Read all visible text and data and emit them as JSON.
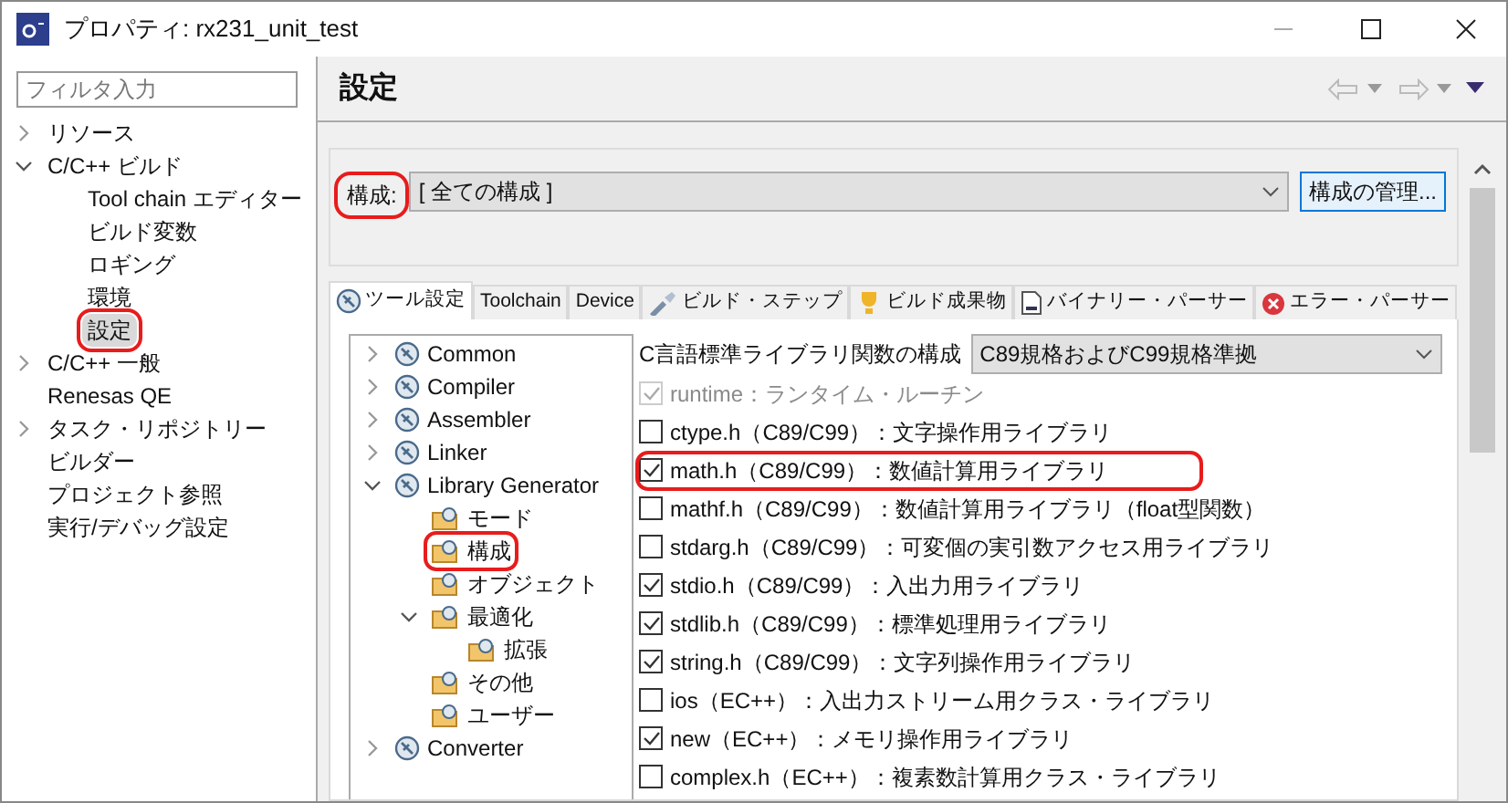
{
  "window": {
    "title": "プロパティ: rx231_unit_test"
  },
  "sidebar": {
    "filter": {
      "placeholder": "フィルタ入力"
    },
    "items": [
      {
        "label": "リソース",
        "expanded": false,
        "selected": false,
        "highlighted": false
      },
      {
        "label": "C/C++ ビルド",
        "expanded": true,
        "selected": false,
        "highlighted": false,
        "children": [
          {
            "label": "Tool chain エディター",
            "selected": false,
            "highlighted": false
          },
          {
            "label": "ビルド変数",
            "selected": false,
            "highlighted": false
          },
          {
            "label": "ロギング",
            "selected": false,
            "highlighted": false
          },
          {
            "label": "環境",
            "selected": false,
            "highlighted": false
          },
          {
            "label": "設定",
            "selected": true,
            "highlighted": true
          }
        ]
      },
      {
        "label": "C/C++ 一般",
        "expanded": false,
        "selected": false,
        "highlighted": false
      },
      {
        "label": "Renesas QE",
        "selected": false,
        "highlighted": false
      },
      {
        "label": "タスク・リポジトリー",
        "expanded": false,
        "selected": false,
        "highlighted": false
      },
      {
        "label": "ビルダー",
        "selected": false,
        "highlighted": false
      },
      {
        "label": "プロジェクト参照",
        "selected": false,
        "highlighted": false
      },
      {
        "label": "実行/デバッグ設定",
        "selected": false,
        "highlighted": false
      }
    ]
  },
  "page": {
    "title": "設定"
  },
  "configuration": {
    "label": "構成:",
    "value": "[ 全ての構成 ]",
    "highlighted": true,
    "manage_button": "構成の管理..."
  },
  "tabs": [
    {
      "label": "ツール設定",
      "selected": true
    },
    {
      "label": "Toolchain",
      "selected": false
    },
    {
      "label": "Device",
      "selected": false
    },
    {
      "label": "ビルド・ステップ",
      "selected": false
    },
    {
      "label": "ビルド成果物",
      "selected": false
    },
    {
      "label": "バイナリー・パーサー",
      "selected": false
    },
    {
      "label": "エラー・パーサー",
      "selected": false
    }
  ],
  "tool_tree": [
    {
      "label": "Common",
      "expanded": false,
      "highlighted": false
    },
    {
      "label": "Compiler",
      "expanded": false,
      "highlighted": false
    },
    {
      "label": "Assembler",
      "expanded": false,
      "highlighted": false
    },
    {
      "label": "Linker",
      "expanded": false,
      "highlighted": false
    },
    {
      "label": "Library Generator",
      "expanded": true,
      "highlighted": false,
      "children": [
        {
          "label": "モード",
          "highlighted": false
        },
        {
          "label": "構成",
          "highlighted": true
        },
        {
          "label": "オブジェクト",
          "highlighted": false
        },
        {
          "label": "最適化",
          "expanded": true,
          "highlighted": false,
          "children": [
            {
              "label": "拡張",
              "highlighted": false
            }
          ]
        },
        {
          "label": "その他",
          "highlighted": false
        },
        {
          "label": "ユーザー",
          "highlighted": false
        }
      ]
    },
    {
      "label": "Converter",
      "expanded": false,
      "highlighted": false
    }
  ],
  "library_config": {
    "label": "C言語標準ライブラリ関数の構成",
    "value": "C89規格およびC99規格準拠"
  },
  "libraries": [
    {
      "label": "runtime：ランタイム・ルーチン",
      "checked": true,
      "disabled": true,
      "highlighted": false
    },
    {
      "label": "ctype.h（C89/C99）：文字操作用ライブラリ",
      "checked": false,
      "disabled": false,
      "highlighted": false
    },
    {
      "label": "math.h（C89/C99）：数値計算用ライブラリ",
      "checked": true,
      "disabled": false,
      "highlighted": true
    },
    {
      "label": "mathf.h（C89/C99）：数値計算用ライブラリ（float型関数）",
      "checked": false,
      "disabled": false,
      "highlighted": false
    },
    {
      "label": "stdarg.h（C89/C99）：可変個の実引数アクセス用ライブラリ",
      "checked": false,
      "disabled": false,
      "highlighted": false
    },
    {
      "label": "stdio.h（C89/C99）：入出力用ライブラリ",
      "checked": true,
      "disabled": false,
      "highlighted": false
    },
    {
      "label": "stdlib.h（C89/C99）：標準処理用ライブラリ",
      "checked": true,
      "disabled": false,
      "highlighted": false
    },
    {
      "label": "string.h（C89/C99）：文字列操作用ライブラリ",
      "checked": true,
      "disabled": false,
      "highlighted": false
    },
    {
      "label": "ios（EC++）：入出力ストリーム用クラス・ライブラリ",
      "checked": false,
      "disabled": false,
      "highlighted": false
    },
    {
      "label": "new（EC++）：メモリ操作用ライブラリ",
      "checked": true,
      "disabled": false,
      "highlighted": false
    },
    {
      "label": "complex.h（EC++）：複素数計算用クラス・ライブラリ",
      "checked": false,
      "disabled": false,
      "highlighted": false
    }
  ]
}
